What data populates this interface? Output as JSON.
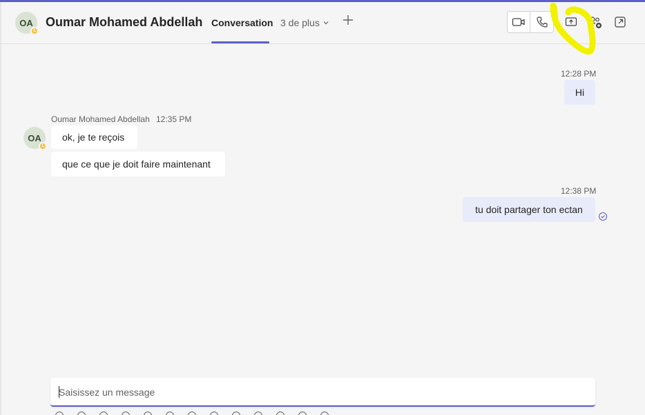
{
  "header": {
    "avatar_initials": "OA",
    "contact_name": "Oumar Mohamed Abdellah",
    "tabs": [
      {
        "label": "Conversation",
        "active": true
      },
      {
        "label": "3 de plus",
        "dropdown": true
      }
    ],
    "add_tab_icon": "plus-icon",
    "actions": [
      "video-call-icon",
      "audio-call-icon",
      "share-screen-icon",
      "add-people-icon",
      "pop-out-icon"
    ]
  },
  "messages": [
    {
      "from": "me",
      "time": "12:28 PM",
      "text": "Hi"
    },
    {
      "from": "them",
      "sender": "Oumar Mohamed Abdellah",
      "time": "12:35 PM",
      "initials": "OA",
      "texts": [
        "ok, je te reçois",
        "que ce que je doit faire maintenant"
      ]
    },
    {
      "from": "me",
      "time": "12:38 PM",
      "text": "tu doit partager ton ectan",
      "status": "seen"
    }
  ],
  "compose": {
    "placeholder": "Saisissez un message"
  },
  "colors": {
    "accent": "#5b5fc7",
    "own_bubble": "#e8ebfa",
    "away_status": "#f8c13b",
    "annotation": "#f2f200"
  }
}
